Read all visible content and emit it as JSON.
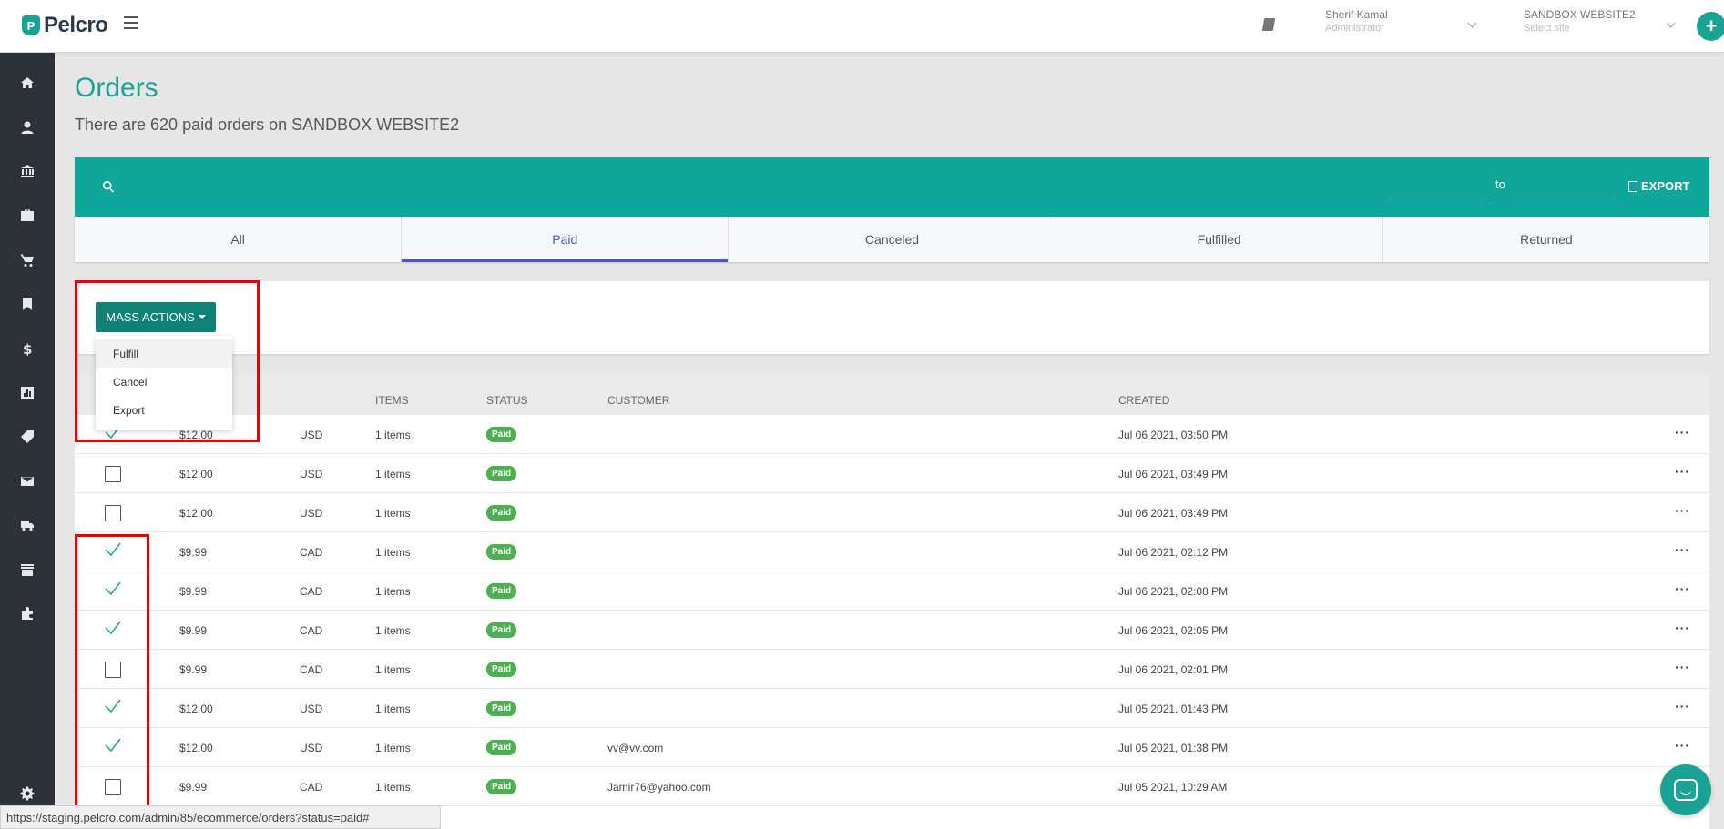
{
  "topbar": {
    "logo_text": "Pelcro",
    "user_name": "Sherif Kamal",
    "user_role": "Administrator",
    "site_name": "SANDBOX WEBSITE2",
    "site_placeholder": "Select site",
    "plus_label": "+"
  },
  "sidebar": {
    "icons": [
      "home-icon",
      "user-icon",
      "bank-icon",
      "briefcase-icon",
      "cart-icon",
      "bookmark-icon",
      "dollar-icon",
      "chart-icon",
      "tag-icon",
      "mail-icon",
      "truck-icon",
      "store-icon",
      "puzzle-icon"
    ],
    "settings_icon": "gear-icon"
  },
  "page": {
    "title": "Orders",
    "subtitle": "There are 620 paid orders on SANDBOX WEBSITE2"
  },
  "filter": {
    "to_label": "to",
    "export_label": "EXPORT"
  },
  "tabs": [
    {
      "label": "All",
      "active": false
    },
    {
      "label": "Paid",
      "active": true
    },
    {
      "label": "Canceled",
      "active": false
    },
    {
      "label": "Fulfilled",
      "active": false
    },
    {
      "label": "Returned",
      "active": false
    }
  ],
  "mass_actions": {
    "button_label": "MASS ACTIONS",
    "items": [
      "Fulfill",
      "Cancel",
      "Export"
    ]
  },
  "table": {
    "headers": {
      "items": "ITEMS",
      "status": "STATUS",
      "customer": "CUSTOMER",
      "created": "CREATED"
    },
    "more_label": "···",
    "rows": [
      {
        "checked": true,
        "amount": "$12.00",
        "currency": "USD",
        "items": "1 items",
        "status": "Paid",
        "customer": "",
        "created": "Jul 06 2021, 03:50 PM"
      },
      {
        "checked": false,
        "amount": "$12.00",
        "currency": "USD",
        "items": "1 items",
        "status": "Paid",
        "customer": "",
        "created": "Jul 06 2021, 03:49 PM"
      },
      {
        "checked": false,
        "amount": "$12.00",
        "currency": "USD",
        "items": "1 items",
        "status": "Paid",
        "customer": "",
        "created": "Jul 06 2021, 03:49 PM"
      },
      {
        "checked": true,
        "amount": "$9.99",
        "currency": "CAD",
        "items": "1 items",
        "status": "Paid",
        "customer": "",
        "created": "Jul 06 2021, 02:12 PM"
      },
      {
        "checked": true,
        "amount": "$9.99",
        "currency": "CAD",
        "items": "1 items",
        "status": "Paid",
        "customer": "",
        "created": "Jul 06 2021, 02:08 PM"
      },
      {
        "checked": true,
        "amount": "$9.99",
        "currency": "CAD",
        "items": "1 items",
        "status": "Paid",
        "customer": "",
        "created": "Jul 06 2021, 02:05 PM"
      },
      {
        "checked": false,
        "amount": "$9.99",
        "currency": "CAD",
        "items": "1 items",
        "status": "Paid",
        "customer": "",
        "created": "Jul 06 2021, 02:01 PM"
      },
      {
        "checked": true,
        "amount": "$12.00",
        "currency": "USD",
        "items": "1 items",
        "status": "Paid",
        "customer": "",
        "created": "Jul 05 2021, 01:43 PM"
      },
      {
        "checked": true,
        "amount": "$12.00",
        "currency": "USD",
        "items": "1 items",
        "status": "Paid",
        "customer": "vv@vv.com",
        "created": "Jul 05 2021, 01:38 PM"
      },
      {
        "checked": false,
        "amount": "$9.99",
        "currency": "CAD",
        "items": "1 items",
        "status": "Paid",
        "customer": "Jamir76@yahoo.com",
        "created": "Jul 05 2021, 10:29 AM"
      }
    ]
  },
  "status_bar": {
    "url": "https://staging.pelcro.com/admin/85/ecommerce/orders?status=paid#"
  },
  "colors": {
    "brand": "#1aa394",
    "mass_button": "#0e8276",
    "active_tab": "#4a55c8",
    "paid_badge": "#4caf50",
    "annotation_red": "#e00000",
    "sidebar": "#2d3238"
  }
}
